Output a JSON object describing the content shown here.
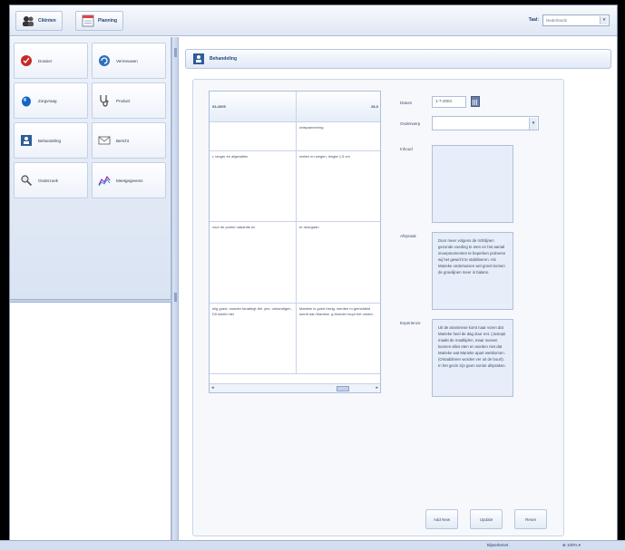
{
  "header": {
    "clients_label": "Cliënten",
    "planning_label": "Planning",
    "lang_label": "Taal:",
    "lang_value": "Nederlands"
  },
  "nav": {
    "items": [
      {
        "label": "Dossier"
      },
      {
        "label": "Vermeuwen"
      },
      {
        "label": "Zorgvraag"
      },
      {
        "label": "Product"
      },
      {
        "label": "Behandeling"
      },
      {
        "label": "Bericht"
      },
      {
        "label": "Onderzoek"
      },
      {
        "label": "Meetgegevens"
      }
    ]
  },
  "panel": {
    "title": "Behandeling"
  },
  "table": {
    "header": [
      "03-2005",
      "28-0"
    ],
    "rows": [
      [
        "",
        "ontspannen/ng"
      ],
      [
        "r, langer en afgevallen",
        "meten en wegen, lengte 1,5 cm"
      ],
      [
        "voor de ponter vakantie en",
        "er doorgaan"
      ],
      [
        "elig goed. moeder fanatiegt tiet. yes. unhandigen, Dit weekt hier",
        "Marieke is goed bezig. werden m gemiddeld werdt dan Marieke, g Moeder loopt het omder."
      ]
    ]
  },
  "form": {
    "datum_label": "Datum",
    "datum_value": "1-7-2004",
    "onderwerp_label": "Onderwerp",
    "onderwerp_value": "",
    "inhoud_label": "Inhoud",
    "inhoud_value": "",
    "afspraak_label": "Afspraak",
    "afspraak_value": "Door meer volgens de richtlijnen gezonde voeding te eten en het aantal snoepmomenten te beperken proberen wij het gewicht te stabiliseren. Als Marieke ondertussen wel groeit komen de groeilijnen meer in balans.",
    "experience_label": "Experience",
    "experience_value": "Uit de anamnese komt naar voren dat Marieke heel de dag door eet. (Josiepti maakt de maaltijden, maar sussen kunnen alles eten en worden niet dat Marieke wat Marieke apart wettkomen. (Ontaddinner worden ver uit de bourt). In het gezin zijn geen sorste afspraken."
  },
  "buttons": {
    "add": "Add New",
    "update": "Update",
    "reset": "Reset"
  },
  "status": {
    "left": "Bijwerkenet",
    "right": "⊕ 100% ▾"
  }
}
